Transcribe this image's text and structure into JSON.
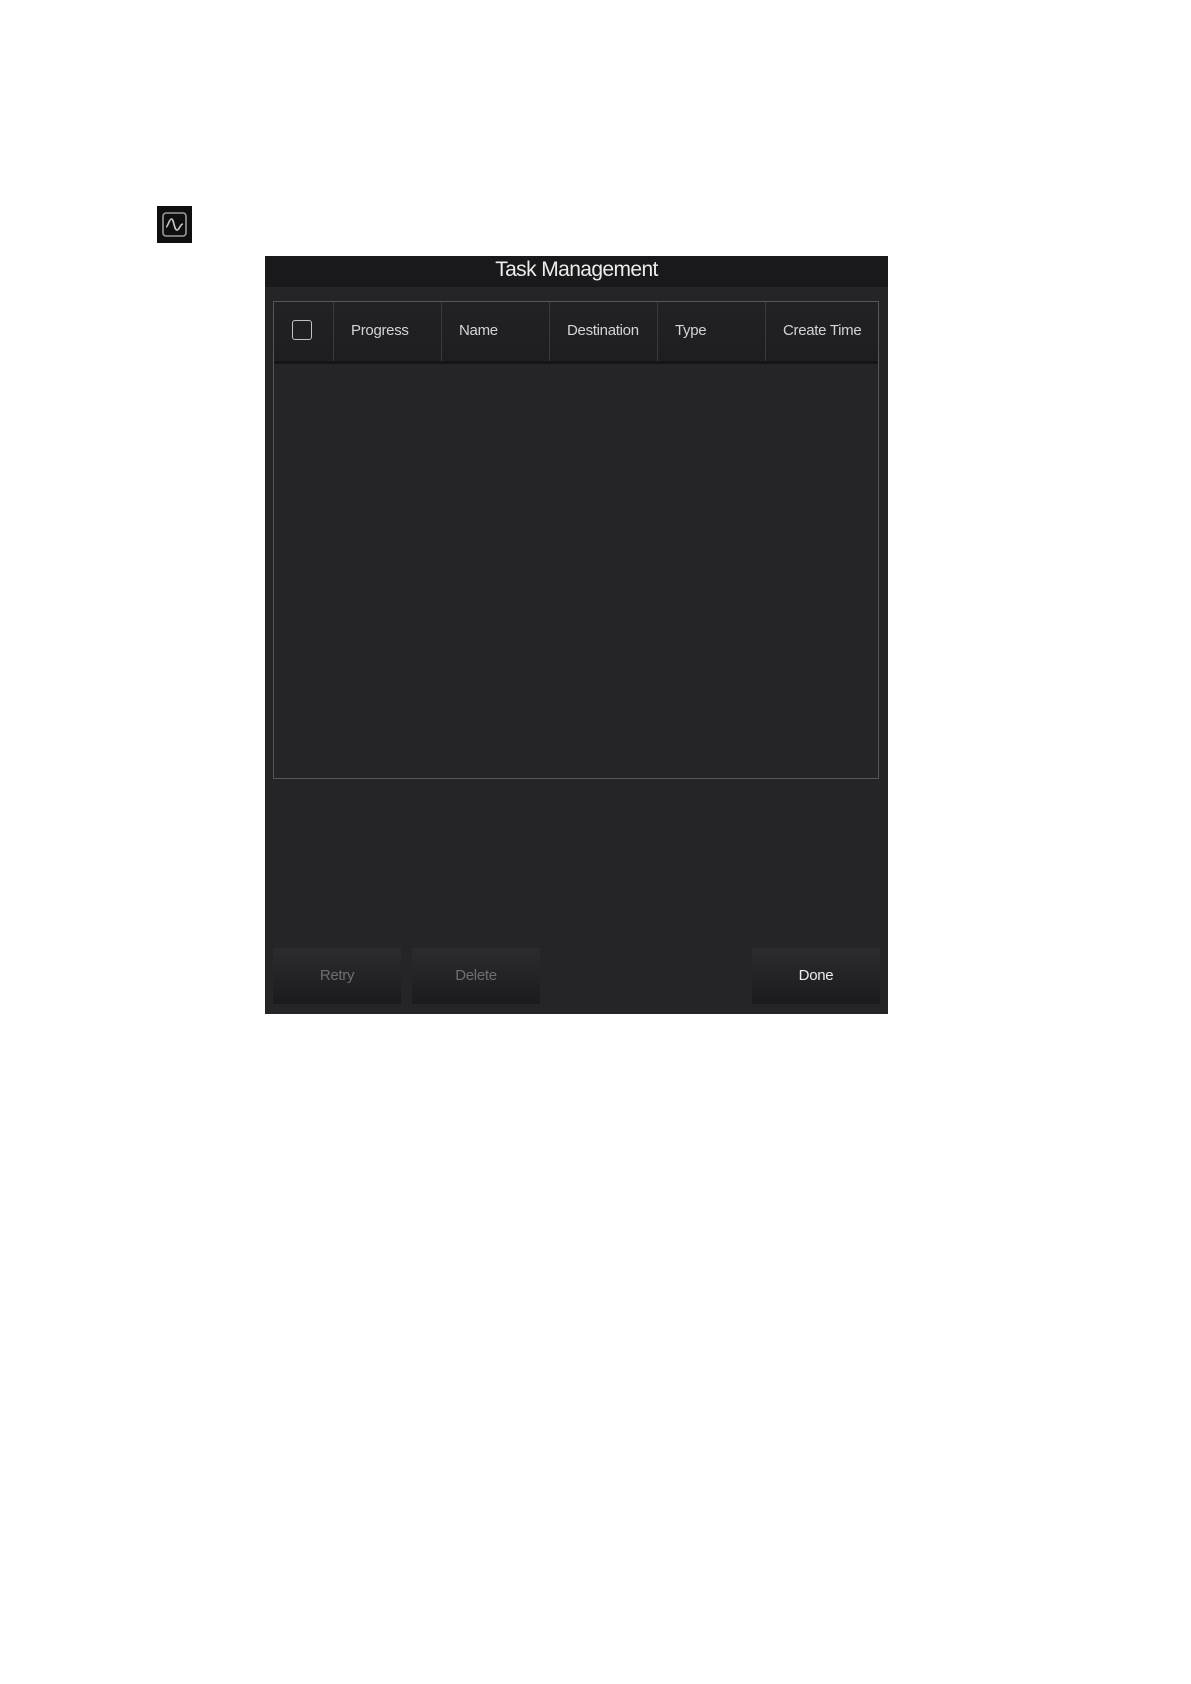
{
  "status_icon": {
    "icon": "waveform-icon"
  },
  "dialog": {
    "title": "Task Management",
    "table": {
      "select_all_checked": false,
      "columns": [
        "Progress",
        "Name",
        "Destination",
        "Type",
        "Create Time"
      ],
      "rows": []
    },
    "buttons": {
      "retry": {
        "label": "Retry",
        "enabled": false
      },
      "delete": {
        "label": "Delete",
        "enabled": false
      },
      "done": {
        "label": "Done",
        "enabled": true
      }
    }
  },
  "colors": {
    "dialog_background": "#252528",
    "title_bar": "#19191b",
    "text": "#d4d4d6",
    "disabled_text": "#6f6f73"
  }
}
